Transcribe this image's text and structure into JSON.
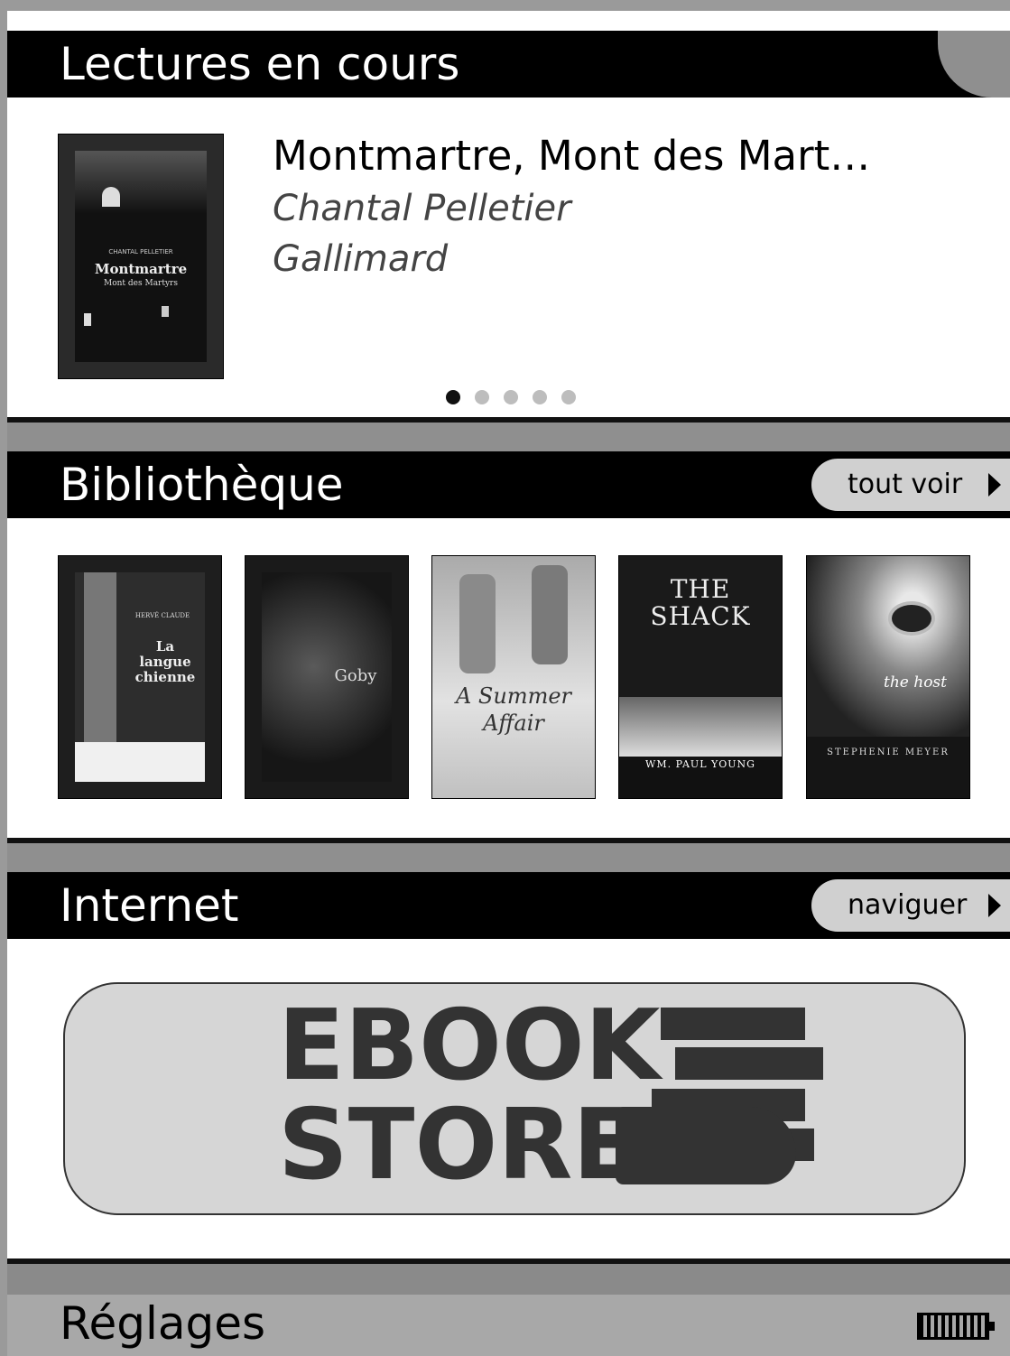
{
  "current_reading": {
    "section_title": "Lectures en cours",
    "book": {
      "title": "Montmartre, Mont des Mart…",
      "author": "Chantal Pelletier",
      "publisher": "Gallimard",
      "cover_lines": [
        "CHANTAL PELLETIER",
        "Montmartre",
        "Mont des Martyrs"
      ]
    },
    "pager": {
      "count": 5,
      "active_index": 0
    }
  },
  "library": {
    "section_title": "Bibliothèque",
    "see_all_label": "tout voir",
    "books": [
      {
        "title_lines": [
          "La",
          "langue",
          "chienne"
        ],
        "small": "HERVÉ CLAUDE"
      },
      {
        "title_lines": [
          "Goby"
        ],
        "small": ""
      },
      {
        "title_lines": [
          "A Summer",
          "Affair"
        ],
        "small": ""
      },
      {
        "title_lines": [
          "THE",
          "SHACK"
        ],
        "small": "WM. PAUL YOUNG"
      },
      {
        "title_lines": [
          "the host"
        ],
        "small": "STEPHENIE MEYER"
      }
    ]
  },
  "internet": {
    "section_title": "Internet",
    "browse_label": "naviguer",
    "store_banner": {
      "line1": "EBOOK",
      "line2": "STORE"
    }
  },
  "settings": {
    "section_title": "Réglages",
    "battery_icon": "battery-full-icon"
  },
  "colors": {
    "bar": "#000000",
    "separator": "#8f8f8f",
    "pill": "#d0d0d0",
    "banner": "#d6d6d6",
    "banner_text": "#333333"
  }
}
